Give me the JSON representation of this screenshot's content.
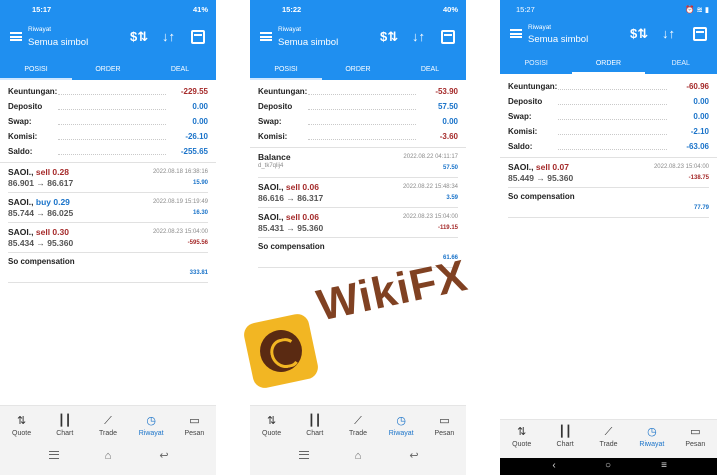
{
  "screens": [
    {
      "status_left": "15:17",
      "status_right": "41%",
      "subtitle": "Riwayat",
      "title": "Semua simbol",
      "tabs": [
        "POSISI",
        "ORDER",
        "DEAL"
      ],
      "active_tab": "POSISI",
      "summary": [
        {
          "label": "Keuntungan:",
          "value": "-229.55"
        },
        {
          "label": "Deposito",
          "value": "0.00"
        },
        {
          "label": "Swap:",
          "value": "0.00"
        },
        {
          "label": "Komisi:",
          "value": "-26.10"
        },
        {
          "label": "Saldo:",
          "value": "-255.65"
        }
      ],
      "trades": [
        {
          "symbol": "SAOI.,",
          "side": "sell 0.28",
          "time": "2022.08.18 16:38:16",
          "price": "86.901 → 86.617",
          "pl": "15.90"
        },
        {
          "symbol": "SAOI.,",
          "side": "buy 0.29",
          "time": "2022.08.19 15:19:49",
          "price": "85.744 → 86.025",
          "pl": "16.30"
        },
        {
          "symbol": "SAOI.,",
          "side": "sell 0.30",
          "time": "2022.08.23 15:04:00",
          "price": "85.434 → 95.360",
          "pl": "-595.56"
        }
      ],
      "compensation": {
        "label": "So compensation",
        "value": "333.81"
      }
    },
    {
      "status_left": "15:22",
      "status_right": "40%",
      "subtitle": "Riwayat",
      "title": "Semua simbol",
      "tabs": [
        "POSISI",
        "ORDER",
        "DEAL"
      ],
      "active_tab": "POSISI",
      "summary": [
        {
          "label": "Keuntungan:",
          "value": "-53.90"
        },
        {
          "label": "Deposito",
          "value": "57.50"
        },
        {
          "label": "Swap:",
          "value": "0.00"
        },
        {
          "label": "Komisi:",
          "value": "-3.60"
        }
      ],
      "balance": {
        "label": "Balance",
        "time": "2022.08.22 04:11:17",
        "sub": "d_tk7qlij4",
        "value": "57.50"
      },
      "trades": [
        {
          "symbol": "SAOI.,",
          "side": "sell 0.06",
          "time": "2022.08.22 15:48:34",
          "price": "86.616 → 86.317",
          "pl": "3.59"
        },
        {
          "symbol": "SAOI.,",
          "side": "sell 0.06",
          "time": "2022.08.23 15:04:00",
          "price": "85.431 → 95.360",
          "pl": "-119.15"
        }
      ],
      "compensation": {
        "label": "So compensation",
        "value": "61.66"
      }
    },
    {
      "status_left": "15:27",
      "subtitle": "Riwayat",
      "title": "Semua simbol",
      "tabs": [
        "POSISI",
        "ORDER",
        "DEAL"
      ],
      "active_tab": "ORDER",
      "summary": [
        {
          "label": "Keuntungan:",
          "value": "-60.96"
        },
        {
          "label": "Deposito",
          "value": "0.00"
        },
        {
          "label": "Swap:",
          "value": "0.00"
        },
        {
          "label": "Komisi:",
          "value": "-2.10"
        },
        {
          "label": "Saldo:",
          "value": "-63.06"
        }
      ],
      "trades": [
        {
          "symbol": "SAOI.,",
          "side": "sell 0.07",
          "time": "2022.08.23 15:04:00",
          "price": "85.449 → 95.360",
          "pl": "-138.75"
        }
      ],
      "compensation": {
        "label": "So compensation",
        "value": "77.79"
      }
    }
  ],
  "nav": [
    "Quote",
    "Chart",
    "Trade",
    "Riwayat",
    "Pesan"
  ],
  "active_nav": "Riwayat",
  "watermark": "WikiFX",
  "colors": {
    "header": "#1f8ff0",
    "positive": "#1a73c9",
    "negative": "#a52a2a",
    "logo": "#f2b623",
    "wordmark": "#7a3717"
  }
}
